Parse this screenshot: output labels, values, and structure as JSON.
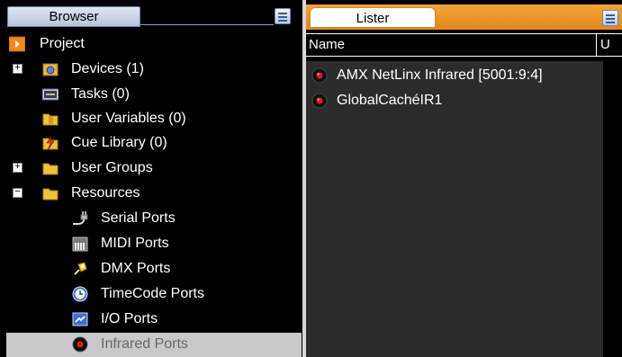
{
  "browser": {
    "tab_label": "Browser",
    "tree": [
      {
        "label": "Project",
        "icon": "project-icon",
        "expander": ""
      },
      {
        "label": "Devices (1)",
        "icon": "devices-icon",
        "expander": "+"
      },
      {
        "label": "Tasks (0)",
        "icon": "tasks-icon",
        "expander": ""
      },
      {
        "label": "User Variables (0)",
        "icon": "user-variables-icon",
        "expander": ""
      },
      {
        "label": "Cue Library (0)",
        "icon": "cue-library-icon",
        "expander": ""
      },
      {
        "label": "User Groups",
        "icon": "folder-icon",
        "expander": "+"
      },
      {
        "label": "Resources",
        "icon": "folder-icon",
        "expander": "−"
      },
      {
        "label": "Serial Ports",
        "icon": "serial-port-icon",
        "expander": ""
      },
      {
        "label": "MIDI Ports",
        "icon": "midi-port-icon",
        "expander": ""
      },
      {
        "label": "DMX Ports",
        "icon": "dmx-port-icon",
        "expander": ""
      },
      {
        "label": "TimeCode Ports",
        "icon": "timecode-port-icon",
        "expander": ""
      },
      {
        "label": "I/O Ports",
        "icon": "io-port-icon",
        "expander": ""
      },
      {
        "label": "Infrared Ports",
        "icon": "infrared-port-icon",
        "expander": ""
      }
    ]
  },
  "lister": {
    "tab_label": "Lister",
    "columns": [
      "Name",
      "U"
    ],
    "items": [
      {
        "label": "AMX NetLinx Infrared [5001:9:4]",
        "icon": "infrared-device-icon"
      },
      {
        "label": "GlobalCachéIR1",
        "icon": "infrared-device-icon"
      }
    ]
  },
  "colors": {
    "accent": "#e98b1f",
    "selection": "#c9c9c9",
    "tab_blue": "#b8c4dc"
  }
}
